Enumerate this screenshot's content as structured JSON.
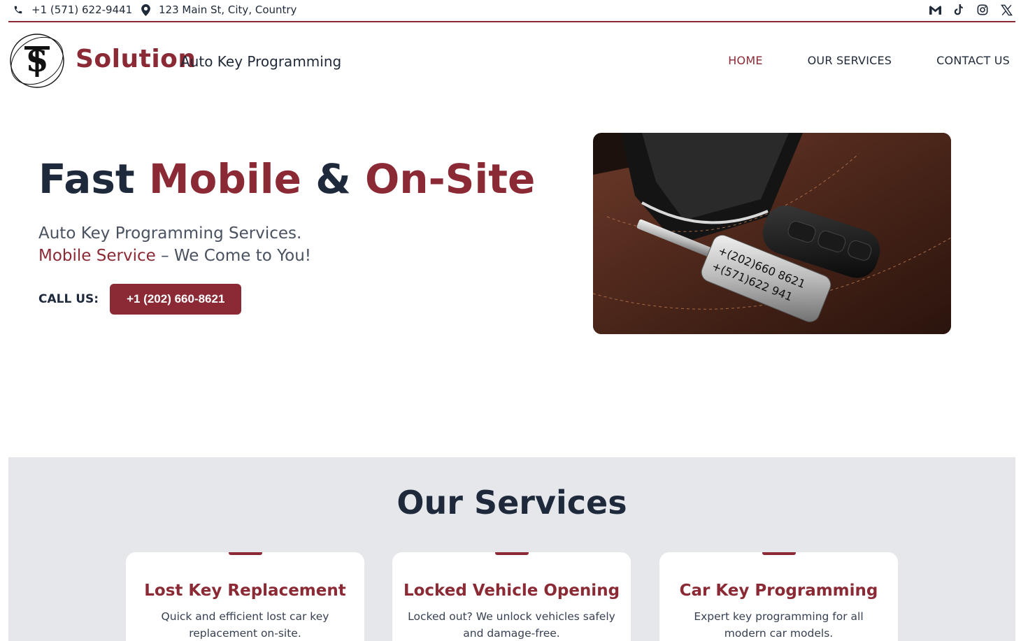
{
  "topbar": {
    "phone": "+1 (571) 622-9441",
    "address": "123 Main St, City, Country",
    "socials": [
      "gmail-icon",
      "tiktok-icon",
      "instagram-icon",
      "x-icon"
    ]
  },
  "header": {
    "brand": "Solution",
    "tagline": "Auto Key Programming",
    "nav": [
      {
        "label": "HOME",
        "active": true
      },
      {
        "label": "OUR SERVICES",
        "active": false
      },
      {
        "label": "CONTACT US",
        "active": false
      }
    ]
  },
  "hero": {
    "title_part1": "Fast ",
    "title_part2": "Mobile",
    "title_part3": " & ",
    "title_part4": "On-Site",
    "subtitle_line1": "Auto Key Programming Services.",
    "subtitle_line2_accent": "Mobile Service",
    "subtitle_line2_rest": " – We Come to You!",
    "call_label": "CALL US:",
    "call_button": "+1 (202) 660-8621",
    "image_key_text_1": "+(202)660 8621",
    "image_key_text_2": "+(571)622 941"
  },
  "services": {
    "title": "Our Services",
    "cards": [
      {
        "title": "Lost Key Replacement",
        "desc": "Quick and efficient lost car key replacement on-site."
      },
      {
        "title": "Locked Vehicle Opening",
        "desc": "Locked out? We unlock vehicles safely and damage-free."
      },
      {
        "title": "Car Key Programming",
        "desc": "Expert key programming for all modern car models."
      }
    ]
  },
  "colors": {
    "accent": "#8b2a35",
    "dark": "#1e2a3b",
    "section_bg": "#e5e7eb"
  }
}
